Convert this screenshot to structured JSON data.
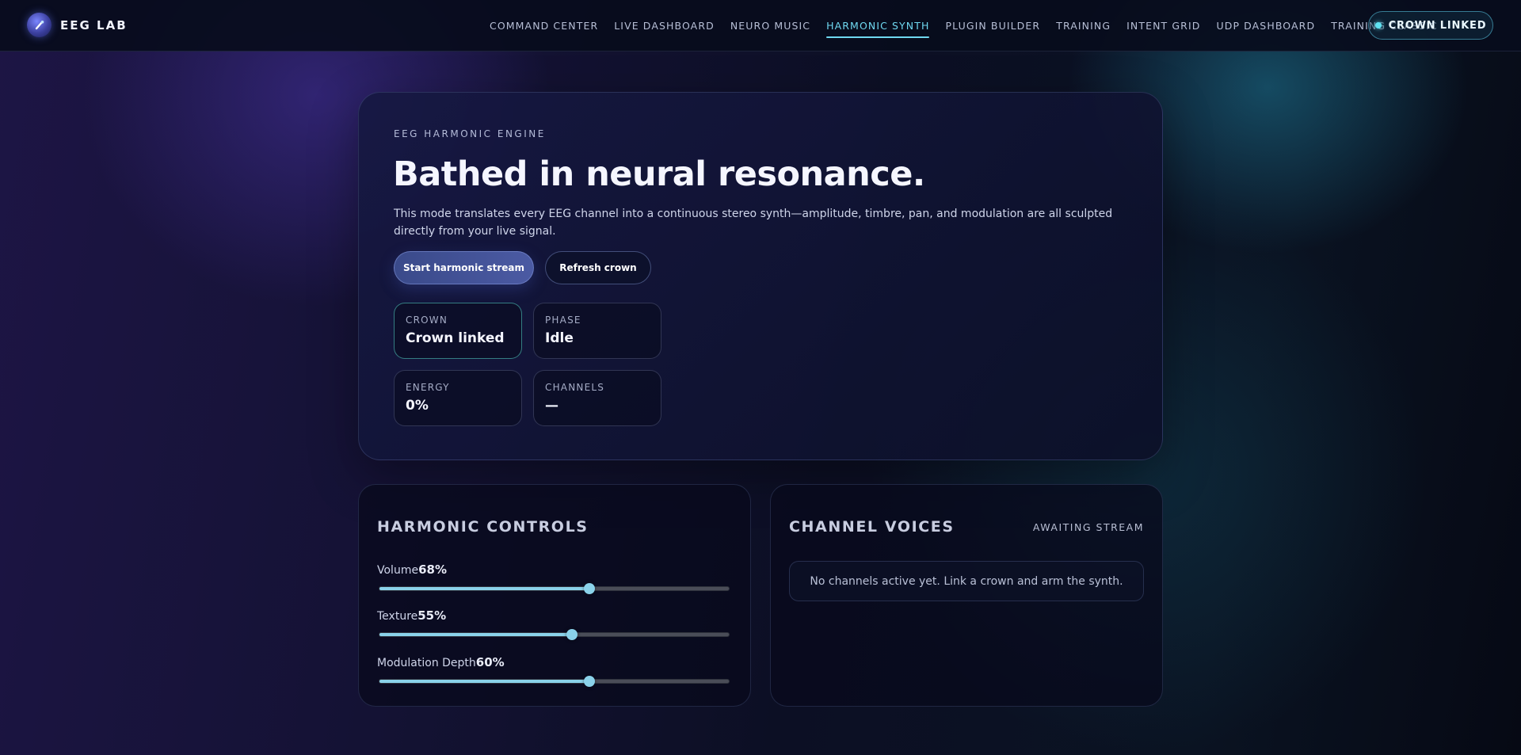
{
  "brand": {
    "name": "EEG LAB",
    "logo_icon": "eeg-probe-icon"
  },
  "nav": {
    "items": [
      {
        "label": "COMMAND CENTER",
        "active": false
      },
      {
        "label": "LIVE DASHBOARD",
        "active": false
      },
      {
        "label": "NEURO MUSIC",
        "active": false
      },
      {
        "label": "HARMONIC SYNTH",
        "active": true
      },
      {
        "label": "PLUGIN BUILDER",
        "active": false
      },
      {
        "label": "TRAINING",
        "active": false
      },
      {
        "label": "INTENT GRID",
        "active": false
      },
      {
        "label": "UDP DASHBOARD",
        "active": false
      },
      {
        "label": "TRAINING CLASSIC",
        "active": false
      }
    ],
    "status_pill": "CROWN LINKED"
  },
  "hero": {
    "eyebrow": "EEG HARMONIC ENGINE",
    "headline": "Bathed in neural resonance.",
    "description": "This mode translates every EEG channel into a continuous stereo synth—amplitude, timbre, pan, and modulation are all sculpted directly from your live signal.",
    "primary_button": "Start harmonic stream",
    "secondary_button": "Refresh crown",
    "stats": {
      "crown": {
        "label": "CROWN",
        "value": "Crown linked"
      },
      "phase": {
        "label": "PHASE",
        "value": "Idle"
      },
      "energy": {
        "label": "ENERGY",
        "value": "0%"
      },
      "channels": {
        "label": "CHANNELS",
        "value": "—"
      }
    }
  },
  "controls": {
    "title": "HARMONIC CONTROLS",
    "sliders": [
      {
        "label": "Volume",
        "value_text": "68%",
        "value": 0.6
      },
      {
        "label": "Texture",
        "value_text": "55%",
        "value": 0.55
      },
      {
        "label": "Modulation Depth",
        "value_text": "60%",
        "value": 0.6
      }
    ]
  },
  "voices": {
    "title": "CHANNEL VOICES",
    "status": "AWAITING STREAM",
    "empty_message": "No channels active yet. Link a crown and arm the synth."
  },
  "colors": {
    "accent": "#6fd8f0",
    "slider_fill": "#8ad2ea",
    "status_dot": "#5fe3f2"
  }
}
